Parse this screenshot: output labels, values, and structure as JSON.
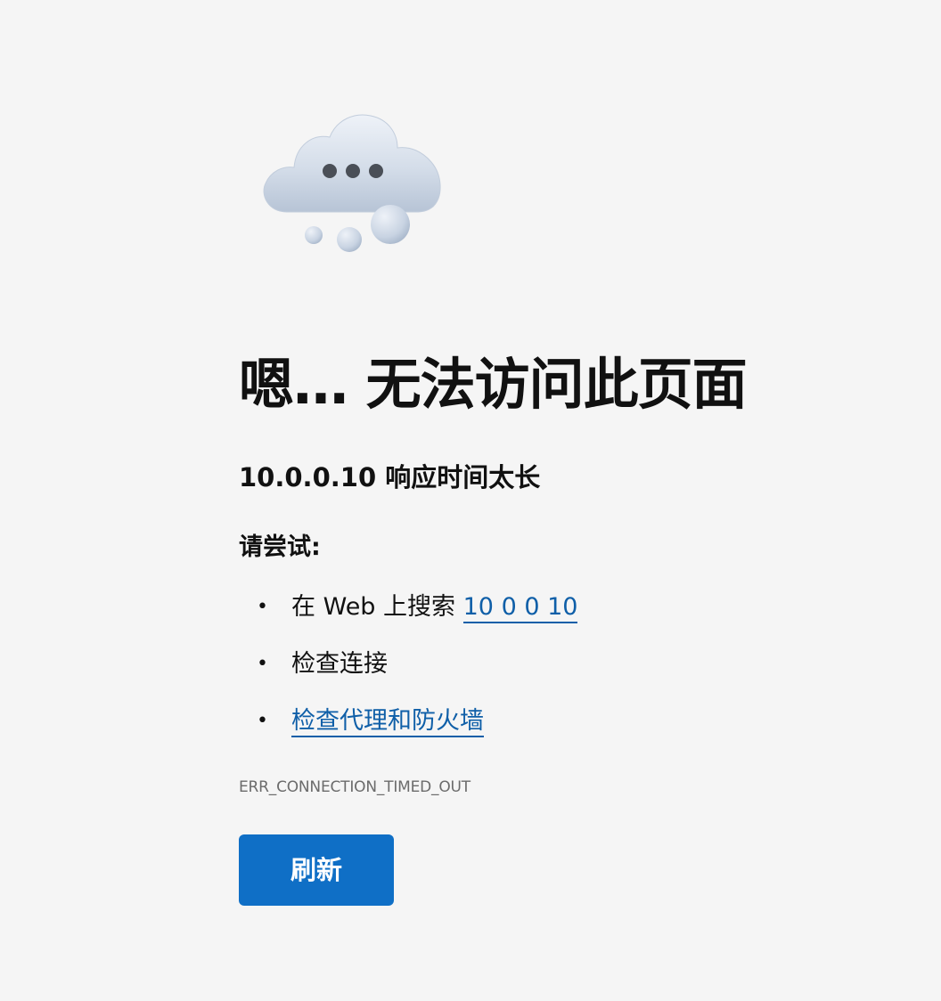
{
  "illustration": {
    "icon": "cloud-thinking-icon"
  },
  "error": {
    "title": "嗯… 无法访问此页面",
    "subtitle": "10.0.0.10 响应时间太长",
    "try_heading": "请尝试:",
    "suggestions": [
      {
        "prefix": "在 Web 上搜索 ",
        "link": "10 0 0 10"
      },
      {
        "text": "检查连接"
      },
      {
        "link": "检查代理和防火墙"
      }
    ],
    "code": "ERR_CONNECTION_TIMED_OUT"
  },
  "actions": {
    "refresh_label": "刷新",
    "refresh_color": "#0f6fc6"
  },
  "colors": {
    "background": "#f5f5f5",
    "link": "#0f5fa8",
    "error_code": "#6b6b6b"
  }
}
